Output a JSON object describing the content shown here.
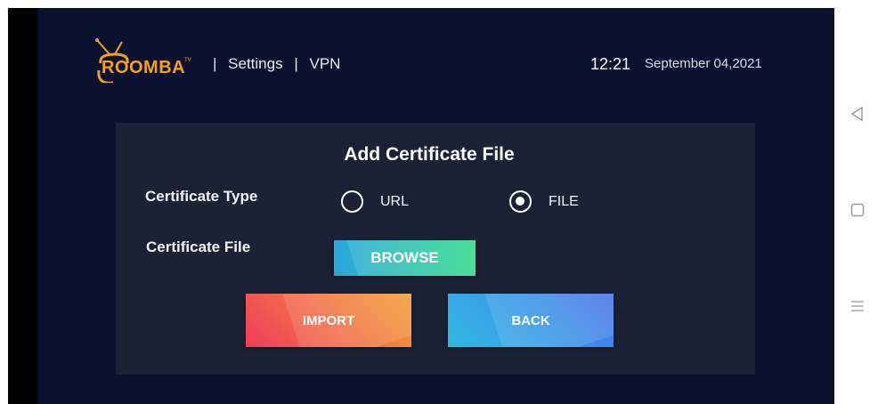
{
  "header": {
    "logo_text": "ROOMBA",
    "logo_superscript": "TV",
    "breadcrumb": [
      {
        "label": "Settings"
      },
      {
        "label": "VPN"
      }
    ],
    "separator": "|",
    "time": "12:21",
    "date": "September 04,2021"
  },
  "dialog": {
    "title": "Add Certificate File",
    "certificate_type_label": "Certificate Type",
    "certificate_file_label": "Certificate File",
    "options": [
      {
        "label": "URL",
        "checked": false
      },
      {
        "label": "FILE",
        "checked": true
      }
    ],
    "browse_label": "BROWSE",
    "import_label": "IMPORT",
    "back_label": "BACK"
  },
  "colors": {
    "background": "#0b1230",
    "panel": "#1b2235",
    "logo": "#f4a020",
    "browse": "#2fc6a8",
    "import": "#f26b4a",
    "back": "#3c95e8"
  },
  "system_nav": {
    "icons": [
      "back-triangle-icon",
      "home-square-icon",
      "menu-lines-icon"
    ]
  }
}
